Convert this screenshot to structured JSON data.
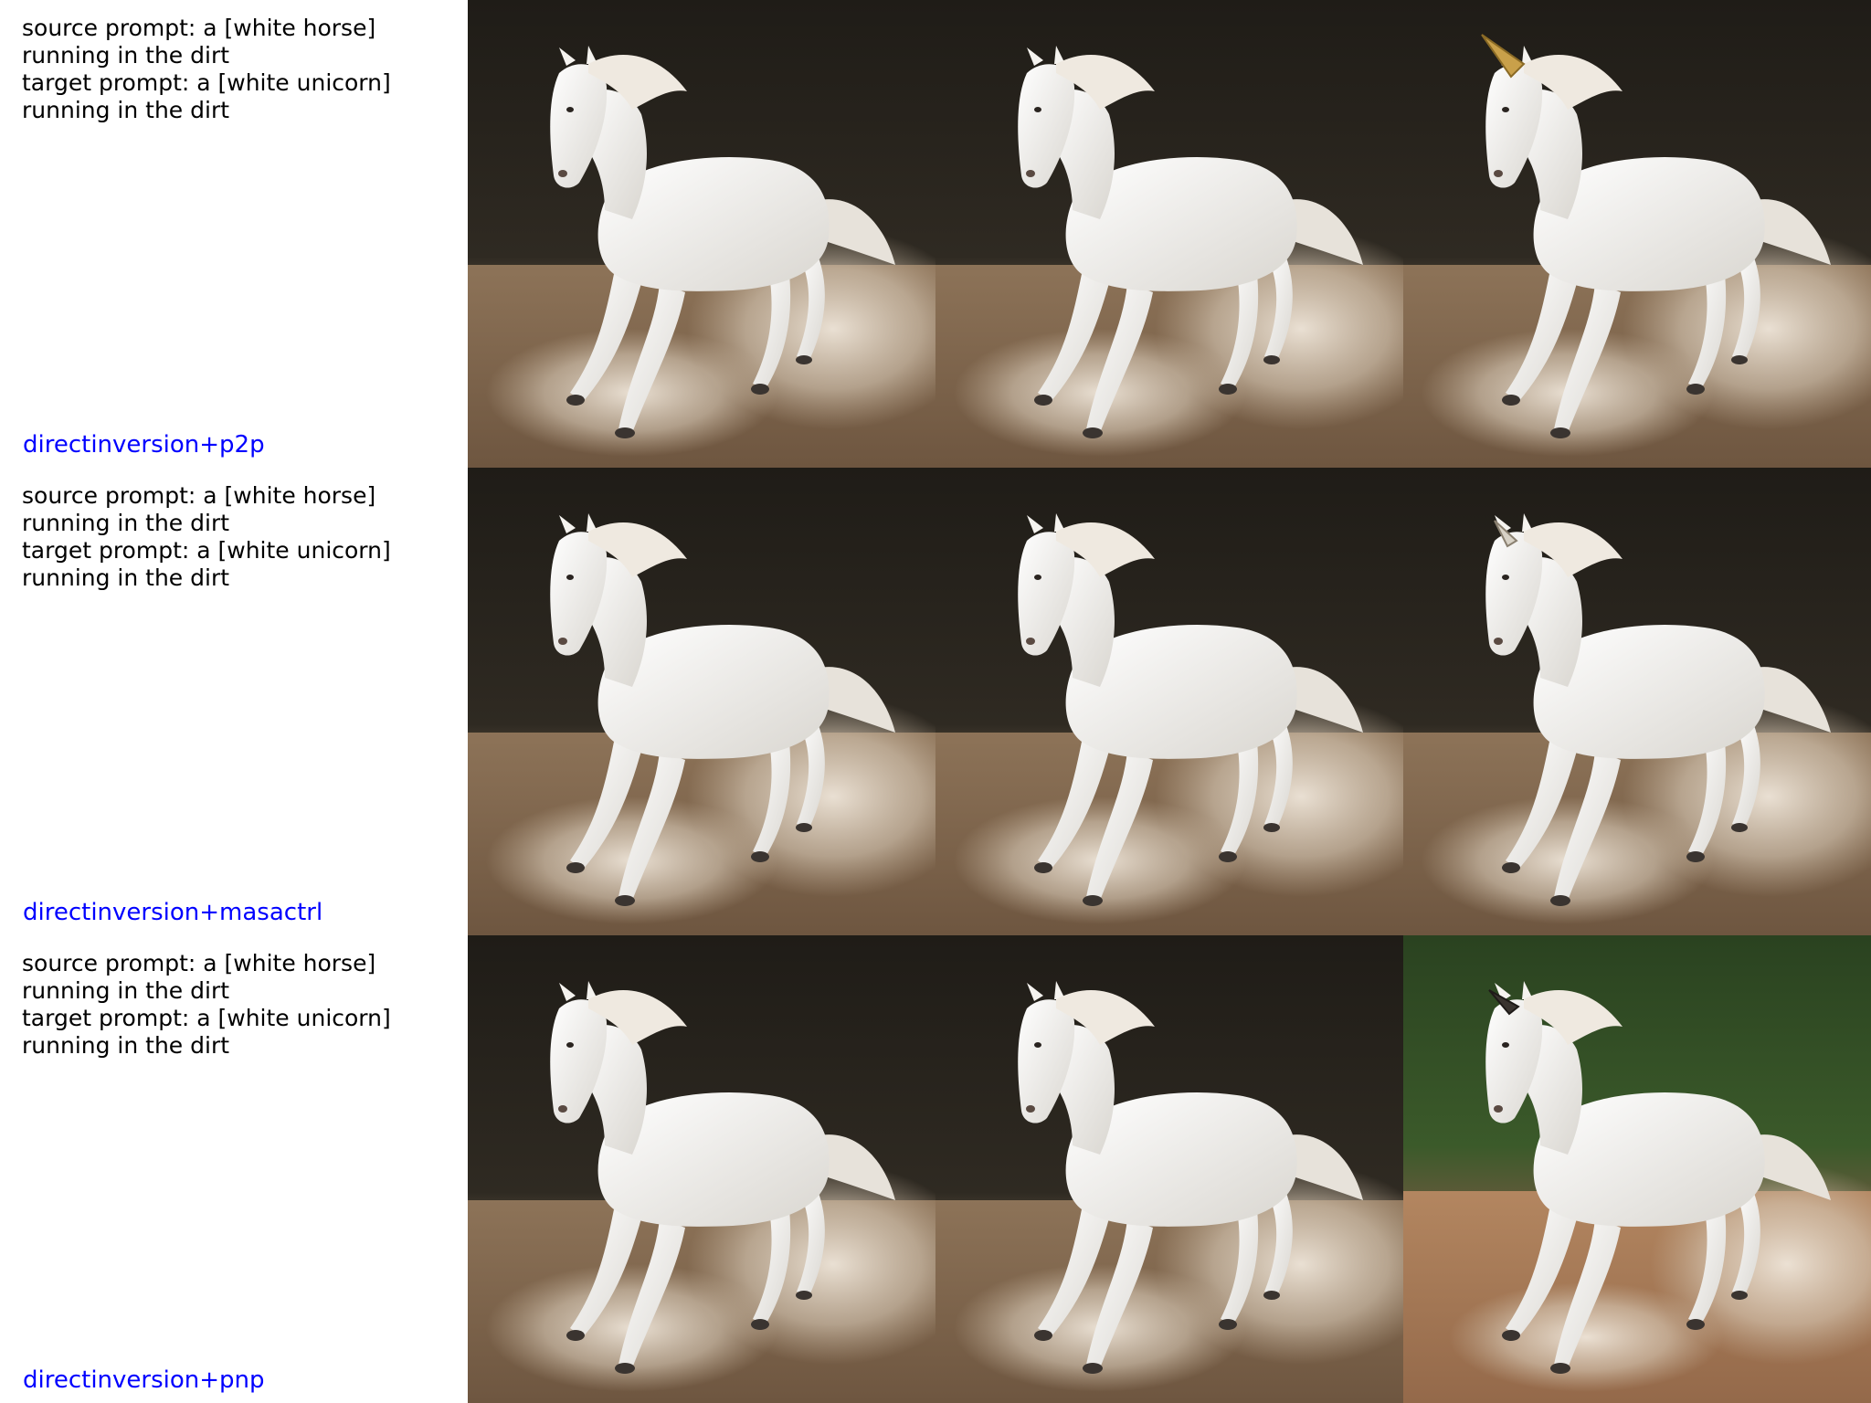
{
  "rows": [
    {
      "prompt_text": "source prompt: a [white horse]\nrunning in the dirt\ntarget prompt: a [white unicorn]\nrunning in the dirt",
      "method": "directinversion+p2p",
      "images": [
        {
          "subject": "white horse running in dust",
          "background": "dark"
        },
        {
          "subject": "white horse running in dust",
          "background": "dark"
        },
        {
          "subject": "white unicorn with golden horn running in dust",
          "background": "dark"
        }
      ]
    },
    {
      "prompt_text": "source prompt: a [white horse]\nrunning in the dirt\ntarget prompt: a [white unicorn]\nrunning in the dirt",
      "method": "directinversion+masactrl",
      "images": [
        {
          "subject": "white horse running in dust",
          "background": "dark"
        },
        {
          "subject": "white horse running in dust",
          "background": "dark"
        },
        {
          "subject": "white unicorn with small horn running in dust",
          "background": "dark"
        }
      ]
    },
    {
      "prompt_text": "source prompt: a [white horse]\nrunning in the dirt\ntarget prompt: a [white unicorn]\nrunning in the dirt",
      "method": "directinversion+pnp",
      "images": [
        {
          "subject": "white horse running in dust",
          "background": "dark"
        },
        {
          "subject": "white horse running in dust",
          "background": "dark"
        },
        {
          "subject": "white unicorn with dark horn running in dust",
          "background": "green"
        }
      ]
    }
  ],
  "colors": {
    "method_label": "#0000ff",
    "prompt_text": "#000000",
    "bg_dark": "#2b2620",
    "bg_green": "#2f4a22",
    "dirt": "#8a6e52",
    "dirt_orange": "#a87a55",
    "horse": "#f2f0ec",
    "horn_gold": "#c9a04a",
    "horn_dark": "#3a3430"
  }
}
